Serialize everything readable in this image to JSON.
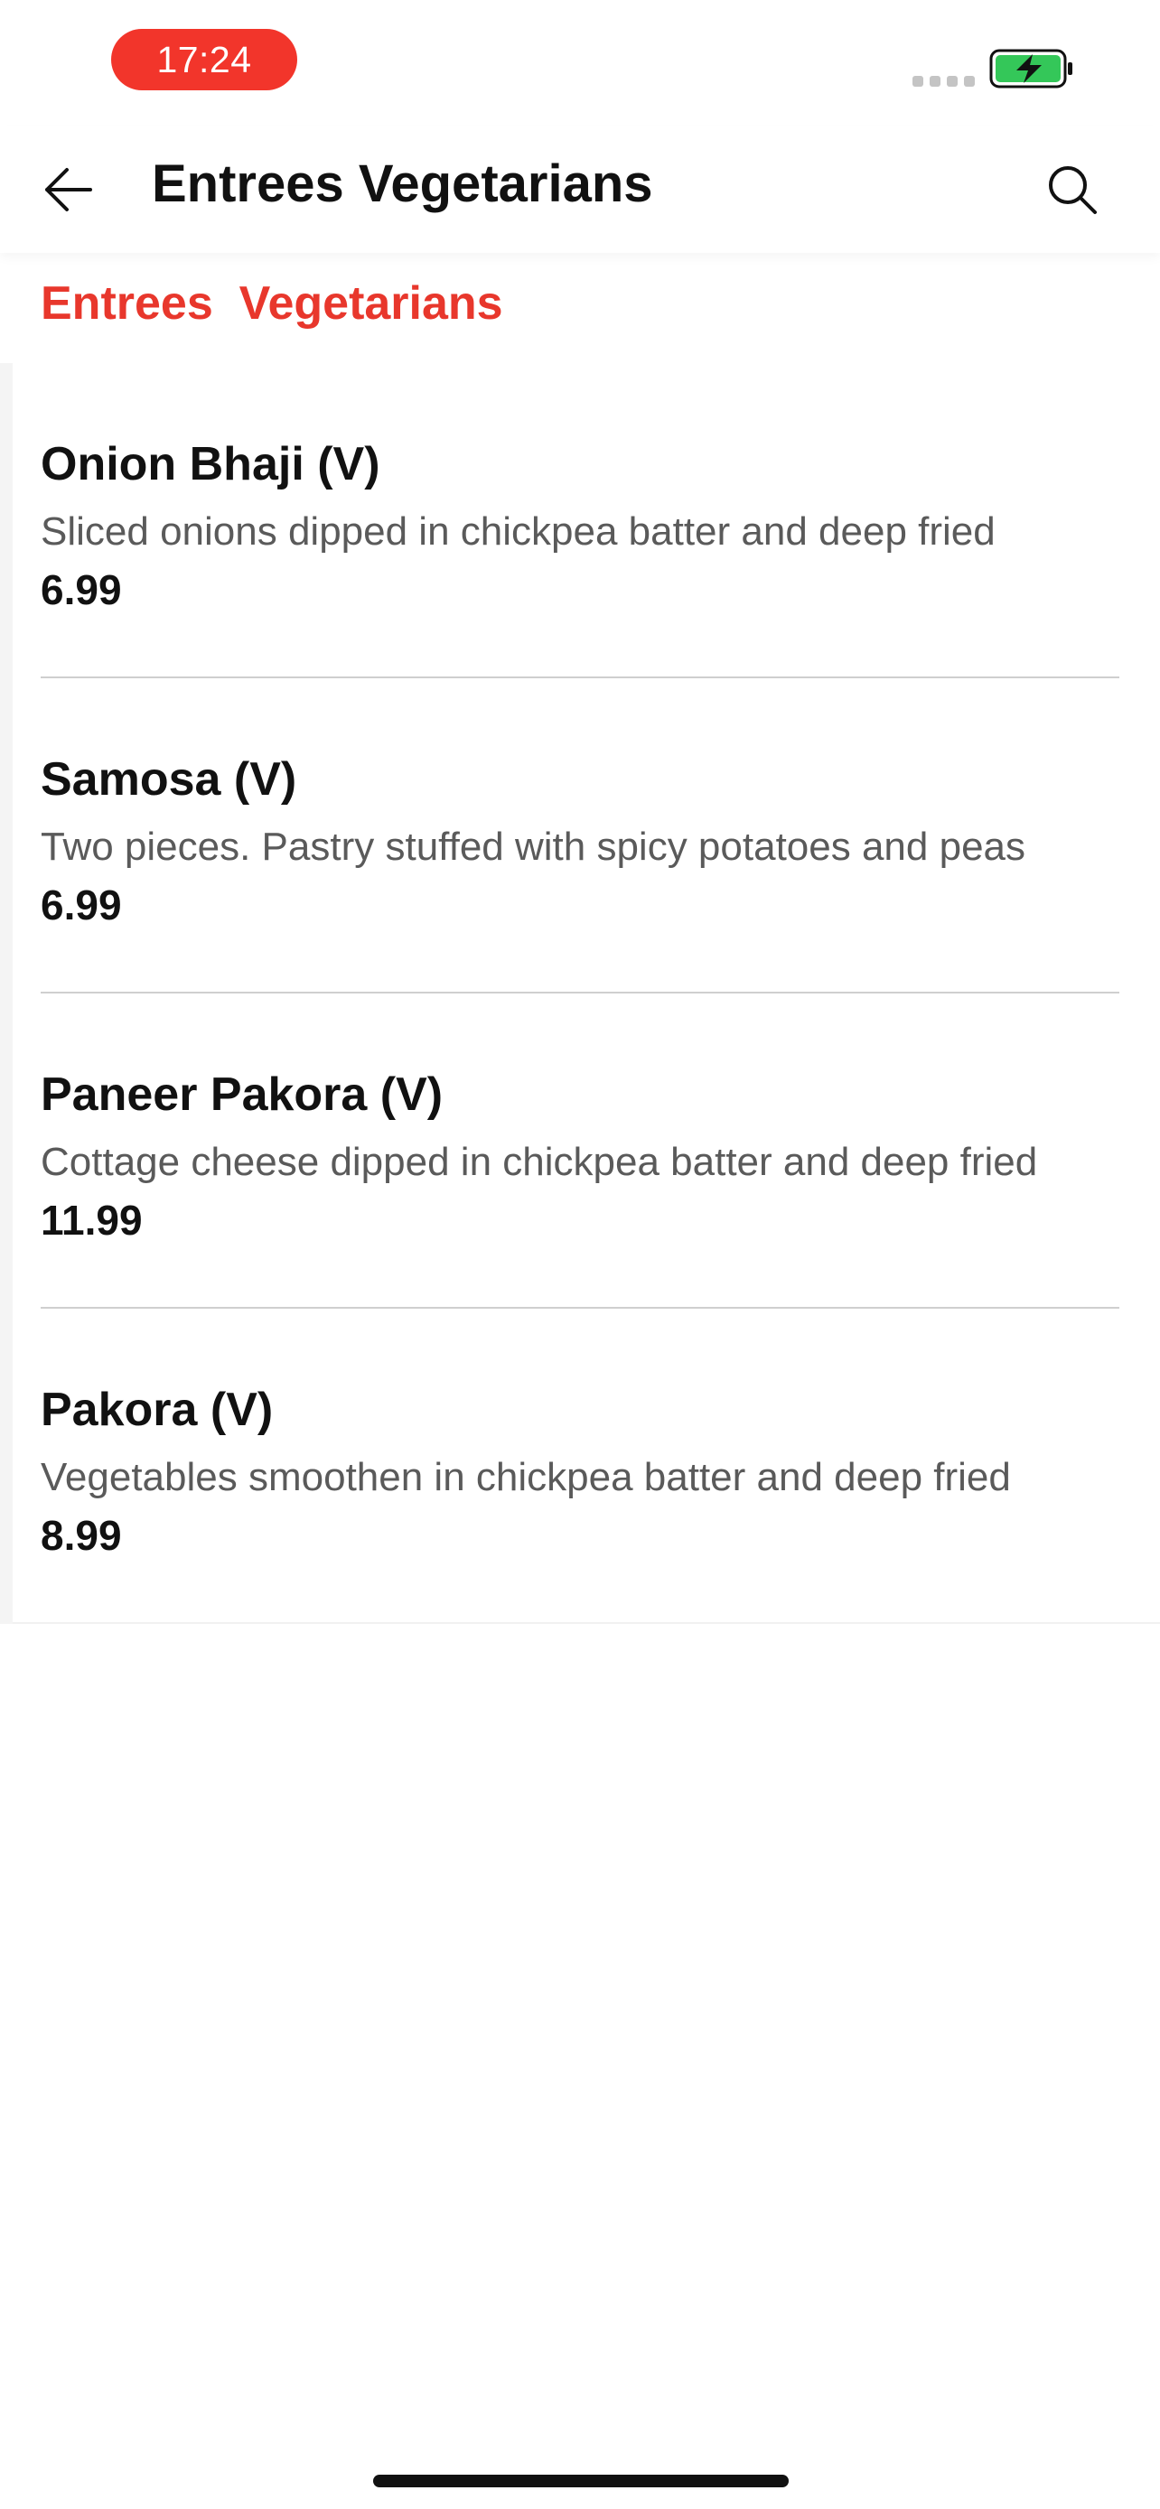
{
  "status_bar": {
    "time": "17:24",
    "time_pill_color": "#f2352b",
    "battery_color": "#34c759",
    "icons": [
      "signal-dots-icon",
      "battery-charging-icon"
    ]
  },
  "header": {
    "title": "Entrees Vegetarians",
    "icons": [
      "back-arrow-icon",
      "search-icon"
    ]
  },
  "category": {
    "heading": "Entrees  Vegetarians",
    "color": "#e8372c"
  },
  "menu_items": [
    {
      "name": "Onion Bhaji (V)",
      "description": "Sliced onions dipped in chickpea batter and deep fried",
      "price": "6.99"
    },
    {
      "name": "Samosa (V)",
      "description": "Two pieces. Pastry stuffed with spicy potatoes and peas",
      "price": "6.99"
    },
    {
      "name": "Paneer Pakora (V)",
      "description": "Cottage cheese dipped in chickpea batter and deep fried",
      "price": "11.99"
    },
    {
      "name": "Pakora (V)",
      "description": "Vegetables smoothen in chickpea batter and deep fried",
      "price": "8.99"
    }
  ]
}
